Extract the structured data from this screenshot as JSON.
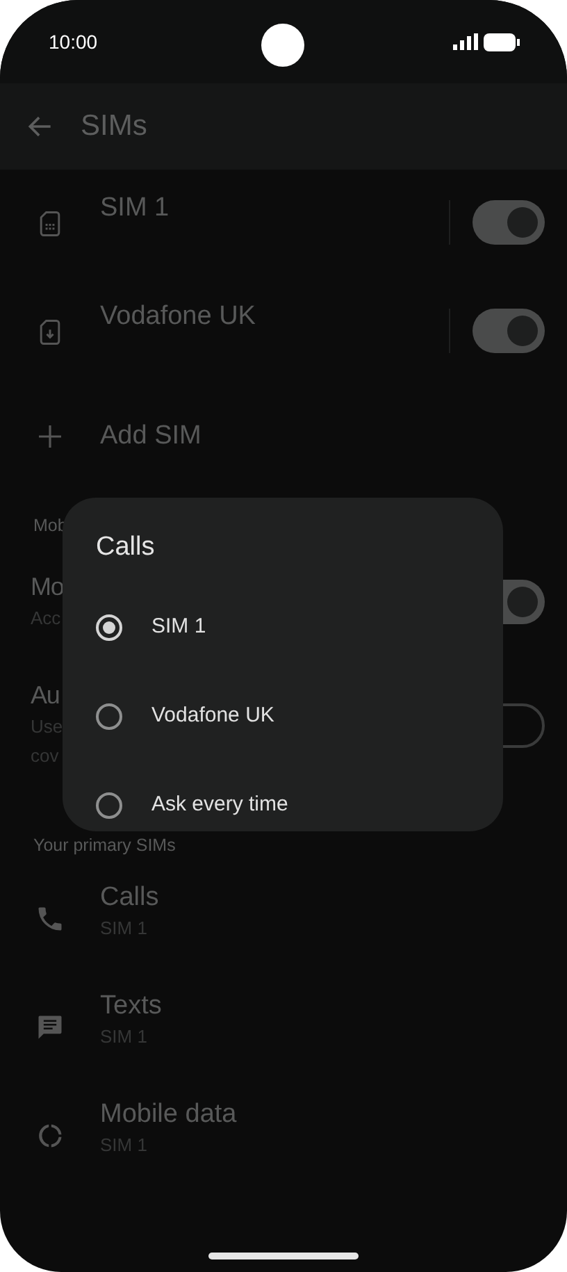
{
  "status_bar": {
    "time": "10:00"
  },
  "app_bar": {
    "title": "SIMs"
  },
  "sims": [
    {
      "kind": "sim",
      "name": "SIM 1",
      "on": true
    },
    {
      "kind": "esim",
      "name": "Vodafone UK",
      "on": true
    }
  ],
  "add_sim": {
    "label": "Add SIM"
  },
  "mobile_section": {
    "header": "Mob",
    "settings": [
      {
        "title": "Mo",
        "subtitle_lines": [
          "Acc"
        ],
        "on": true
      },
      {
        "title": "Au",
        "subtitle_lines": [
          "Use",
          "cov"
        ],
        "on": false
      }
    ]
  },
  "primary_section": {
    "header": "Your primary SIMs",
    "items": [
      {
        "kind": "calls",
        "title": "Calls",
        "value": "SIM 1"
      },
      {
        "kind": "texts",
        "title": "Texts",
        "value": "SIM 1"
      },
      {
        "kind": "data",
        "title": "Mobile data",
        "value": "SIM 1"
      }
    ]
  },
  "dialog": {
    "title": "Calls",
    "options": [
      {
        "label": "SIM 1",
        "selected": true
      },
      {
        "label": "Vodafone UK",
        "selected": false
      },
      {
        "label": "Ask every time",
        "selected": false
      }
    ]
  }
}
